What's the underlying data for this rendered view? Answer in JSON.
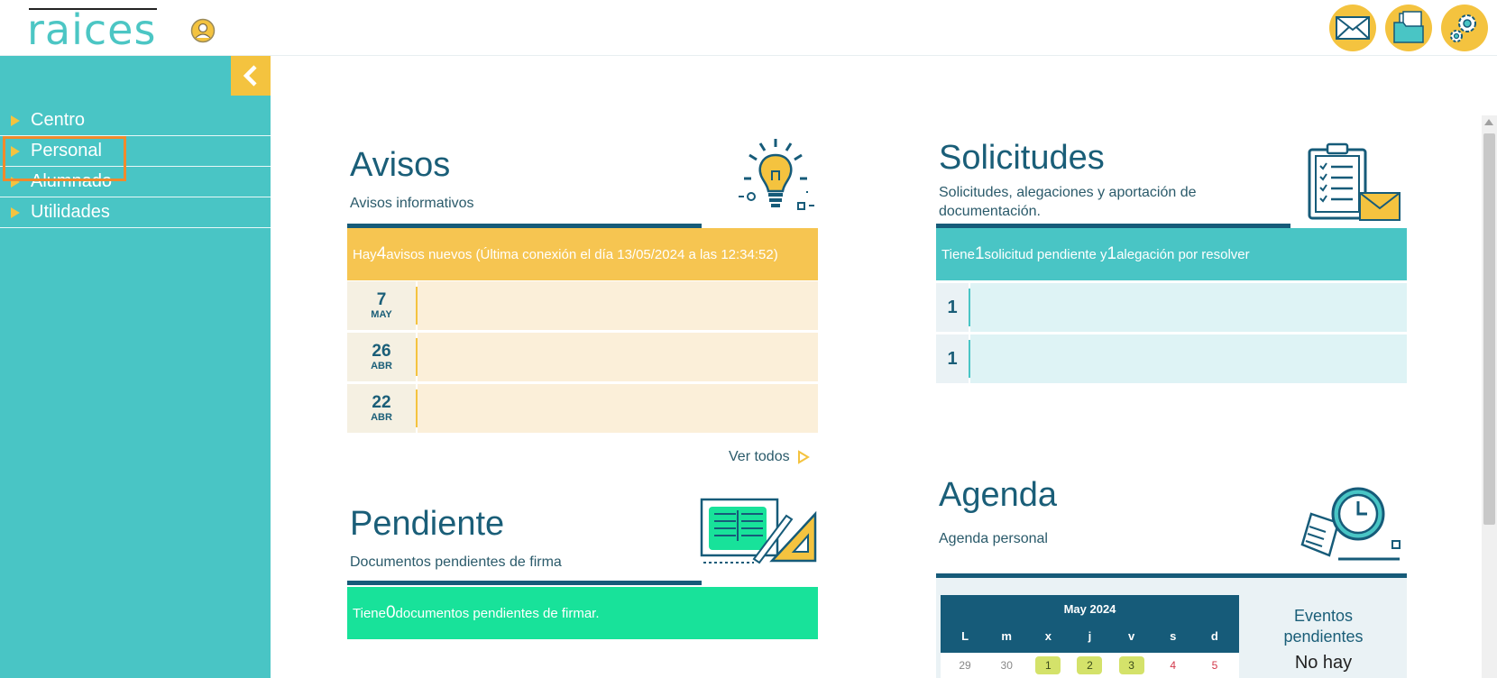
{
  "header": {
    "logo_text": "raices",
    "icons": [
      "user-icon",
      "mail-icon",
      "documents-icon",
      "settings-icon"
    ]
  },
  "sidebar": {
    "items": [
      {
        "label": "Centro"
      },
      {
        "label": "Personal"
      },
      {
        "label": "Alumnado"
      },
      {
        "label": "Utilidades"
      }
    ]
  },
  "avisos": {
    "title": "Avisos",
    "subtitle": "Avisos informativos",
    "banner_prefix": "Hay ",
    "banner_count": "4",
    "banner_suffix": " avisos nuevos (Última conexión el día 13/05/2024 a las 12:34:52)",
    "rows": [
      {
        "day": "7",
        "month": "MAY"
      },
      {
        "day": "26",
        "month": "ABR"
      },
      {
        "day": "22",
        "month": "ABR"
      }
    ],
    "see_all": "Ver todos"
  },
  "pendiente": {
    "title": "Pendiente",
    "subtitle": "Documentos pendientes de firma",
    "banner_prefix": "Tiene ",
    "banner_count": "0",
    "banner_suffix": " documentos pendientes de firmar."
  },
  "solicitudes": {
    "title": "Solicitudes",
    "subtitle_line1": "Solicitudes, alegaciones y aportación de",
    "subtitle_line2": "documentación.",
    "banner_prefix": "Tiene ",
    "banner_count1": "1",
    "banner_mid": " solicitud pendiente y ",
    "banner_count2": "1",
    "banner_suffix": " alegación por resolver",
    "rows": [
      {
        "count": "1"
      },
      {
        "count": "1"
      }
    ]
  },
  "agenda": {
    "title": "Agenda",
    "subtitle": "Agenda personal",
    "calendar": {
      "month_label": "May 2024",
      "weekdays": [
        "L",
        "m",
        "x",
        "j",
        "v",
        "s",
        "d"
      ],
      "first_row": [
        "29",
        "30",
        "1",
        "2",
        "3",
        "4",
        "5"
      ]
    },
    "events_title_line1": "Eventos",
    "events_title_line2": "pendientes",
    "events_value": "No hay"
  },
  "colors": {
    "teal": "#49c5c5",
    "yellow": "#f4c33f",
    "navy": "#165b79",
    "green": "#18e29a",
    "highlight": "#f08a2c"
  }
}
